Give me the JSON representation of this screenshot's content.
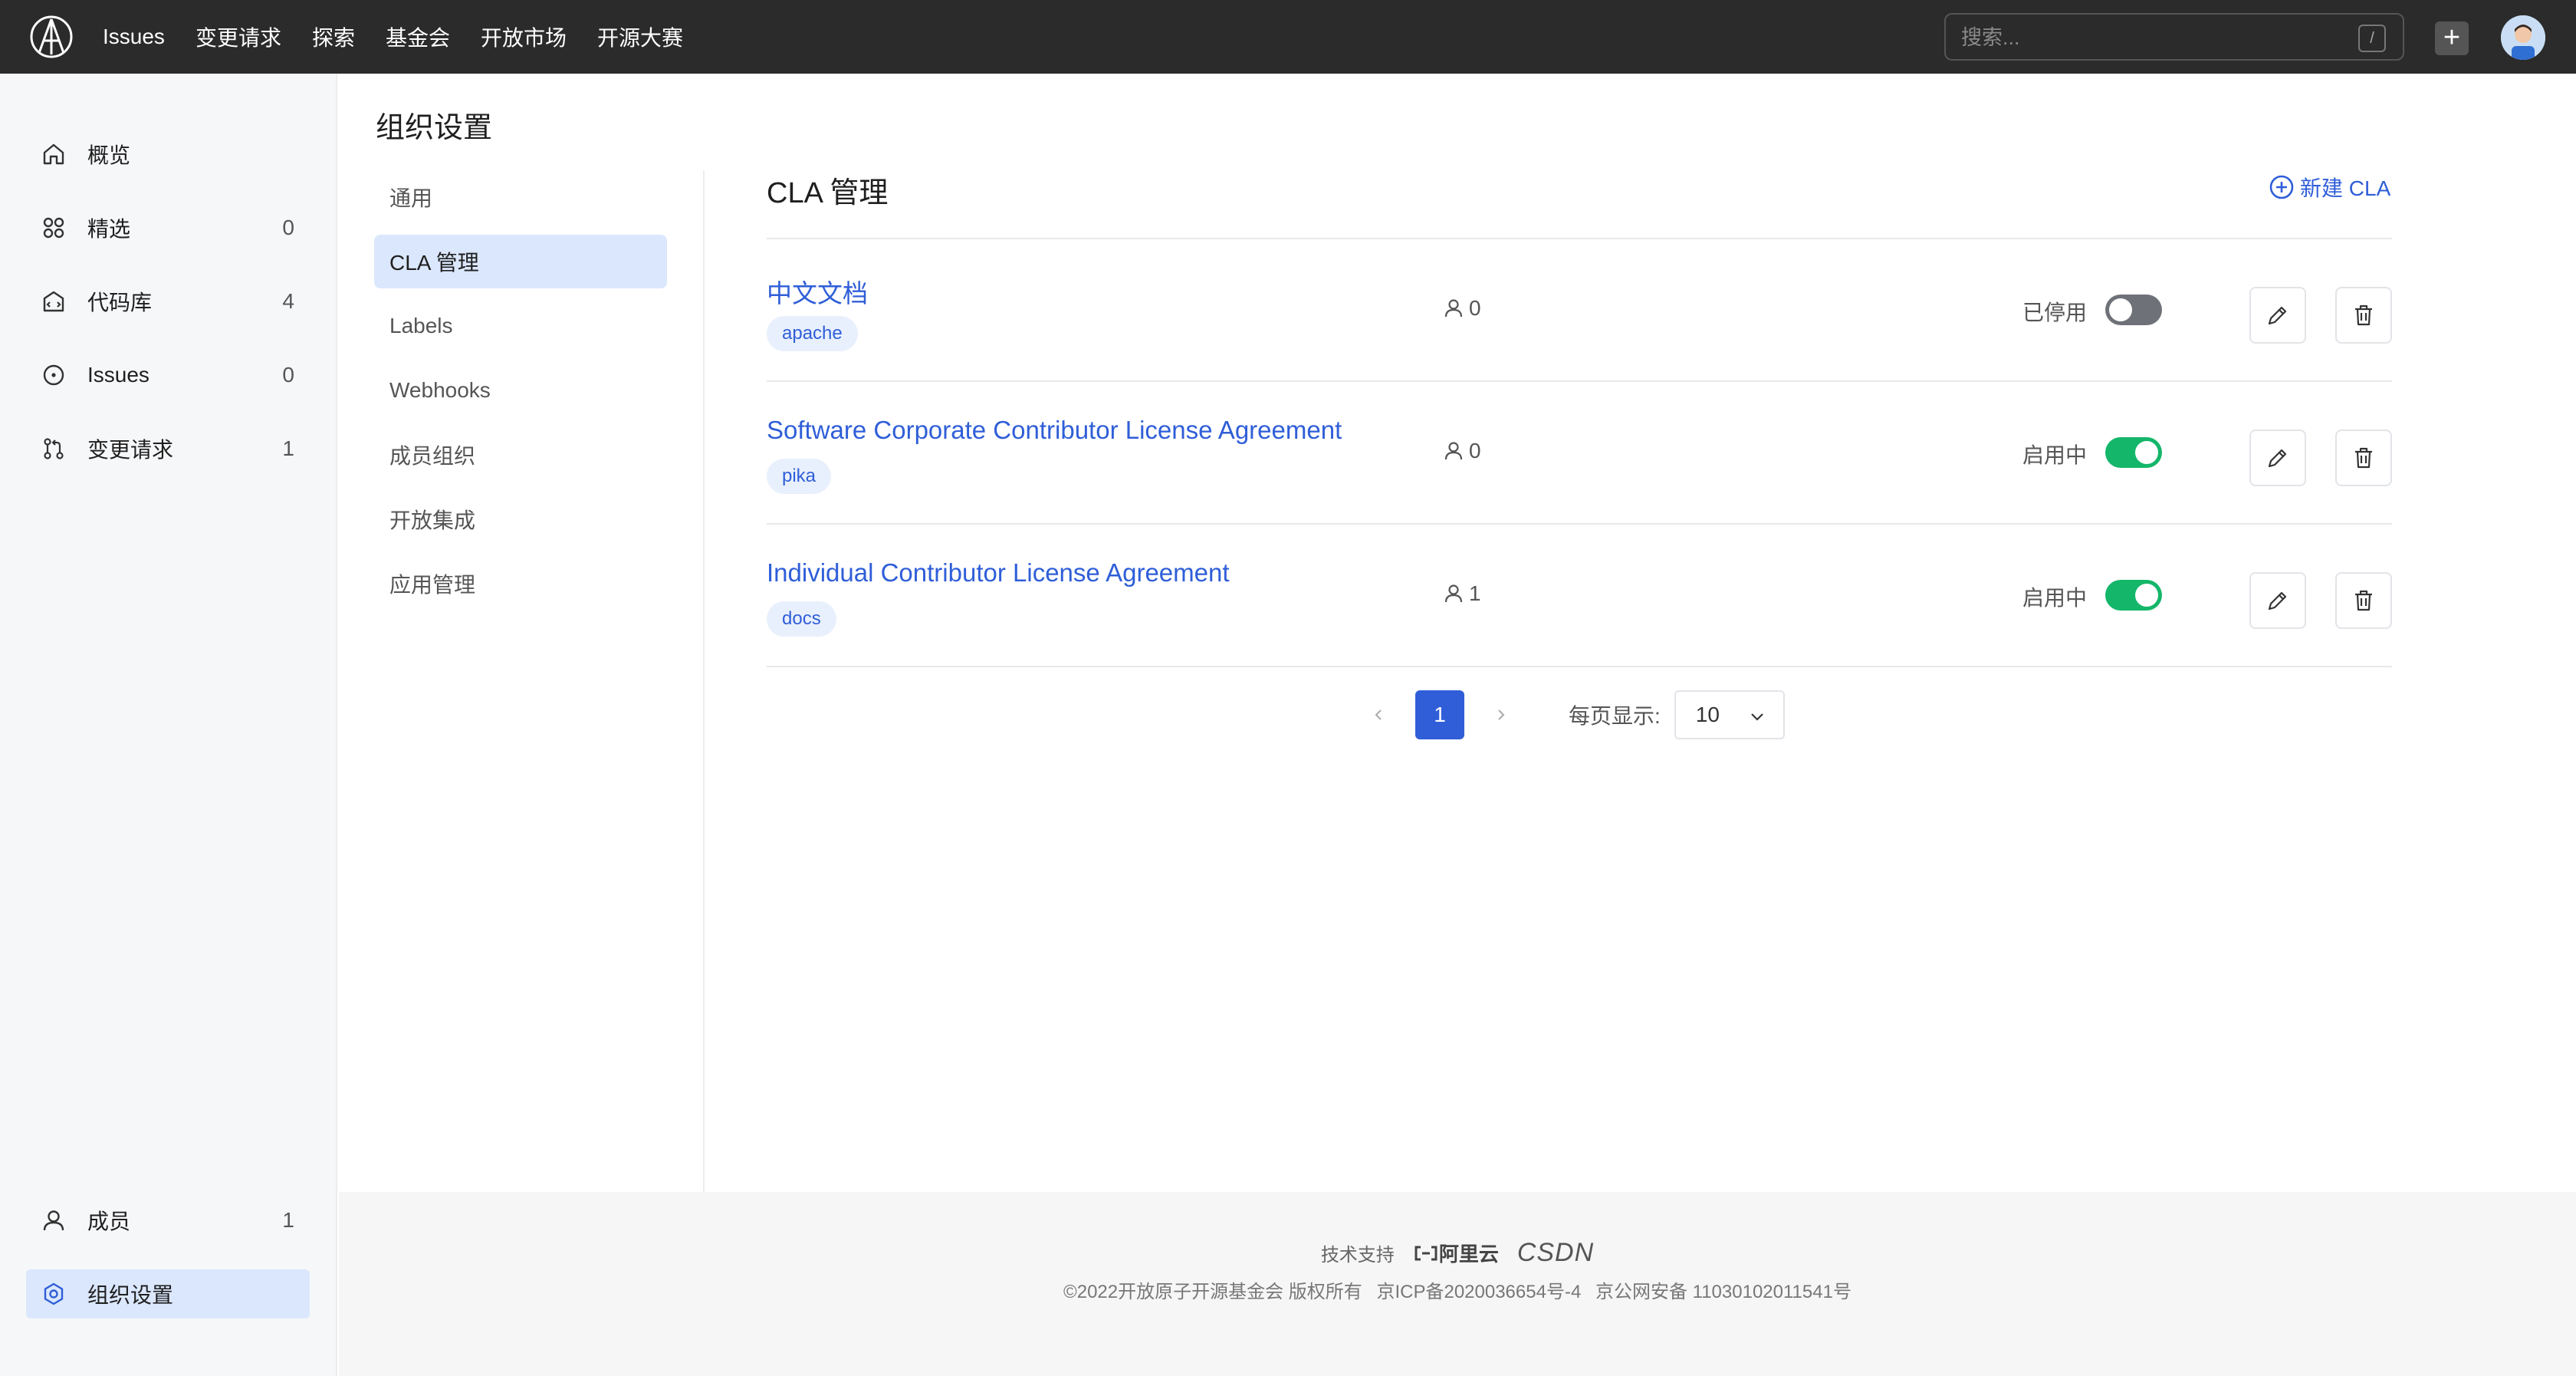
{
  "topbar": {
    "nav": [
      "Issues",
      "变更请求",
      "探索",
      "基金会",
      "开放市场",
      "开源大赛"
    ],
    "search_placeholder": "搜索...",
    "search_shortcut": "/",
    "plus_label": "+"
  },
  "sidebar": {
    "items": [
      {
        "label": "概览",
        "count": "",
        "icon": "home-icon"
      },
      {
        "label": "精选",
        "count": "0",
        "icon": "grid-icon"
      },
      {
        "label": "代码库",
        "count": "4",
        "icon": "repo-icon"
      },
      {
        "label": "Issues",
        "count": "0",
        "icon": "issue-icon"
      },
      {
        "label": "变更请求",
        "count": "1",
        "icon": "pull-request-icon"
      }
    ],
    "bottom": [
      {
        "label": "成员",
        "count": "1",
        "icon": "user-icon"
      },
      {
        "label": "组织设置",
        "count": "",
        "icon": "settings-icon"
      }
    ]
  },
  "page_title": "组织设置",
  "subnav": [
    "通用",
    "CLA 管理",
    "Labels",
    "Webhooks",
    "成员组织",
    "开放集成",
    "应用管理"
  ],
  "subnav_active": "CLA 管理",
  "cla": {
    "title": "CLA 管理",
    "new_label": "新建 CLA",
    "rows": [
      {
        "name": "中文文档",
        "tag": "apache",
        "members": "0",
        "status": "已停用",
        "enabled": false
      },
      {
        "name": "Software Corporate Contributor License Agreement",
        "tag": "pika",
        "members": "0",
        "status": "启用中",
        "enabled": true
      },
      {
        "name": "Individual Contributor License Agreement",
        "tag": "docs",
        "members": "1",
        "status": "启用中",
        "enabled": true
      }
    ]
  },
  "pagination": {
    "current": "1",
    "page_size_label": "每页显示:",
    "page_size": "10"
  },
  "footer": {
    "support_label": "技术支持",
    "aliyun": "阿里云",
    "csdn": "CSDN",
    "copyright": "©2022开放原子开源基金会 版权所有",
    "icp": "京ICP备2020036654号-4",
    "police": "京公网安备 11030102011541号"
  },
  "colors": {
    "topbar": "#2b2b2b",
    "accent": "#2f5ed8",
    "active_bg": "#dbe7fd",
    "toggle_on": "#14b66a",
    "toggle_off": "#6e7178"
  }
}
